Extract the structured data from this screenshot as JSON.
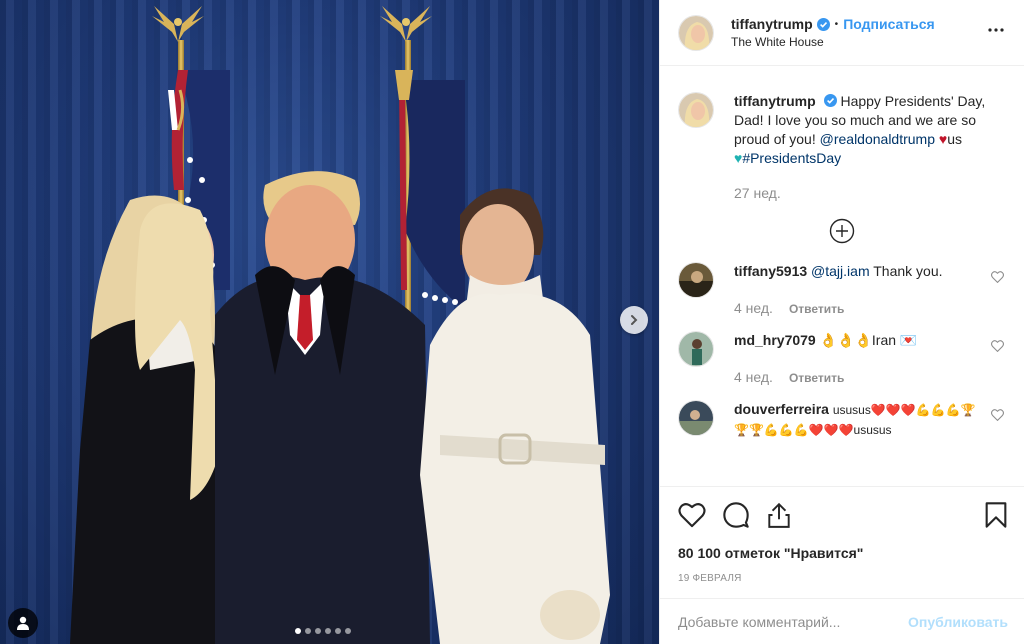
{
  "post": {
    "username": "tiffanytrump",
    "follow_label": "Подписаться",
    "separator": "•",
    "location": "The White House",
    "caption": {
      "username": "tiffanytrump",
      "text_part1": "Happy Presidents' Day, Dad! I love you so much and we are so proud of you! ",
      "mention": "@realdonaldtrump",
      "heart": "♥",
      "text_part2": "us",
      "heart2": "♥",
      "hashtag": "#PresidentsDay",
      "time": "27 нед."
    },
    "comments": [
      {
        "username": "tiffany5913",
        "mention": "@tajj.iam",
        "text": " Thank you.",
        "time": "4 нед.",
        "reply": "Ответить"
      },
      {
        "username": "md_hry7079",
        "text": "👌👌👌Iran 💌",
        "time": "4 нед.",
        "reply": "Ответить"
      },
      {
        "username": "douverferreira",
        "text": "ususus❤️❤️❤️💪💪💪🏆🏆🏆💪💪💪❤️❤️❤️ususus",
        "time": "",
        "reply": ""
      }
    ],
    "likes": "80 100 отметок \"Нравится\"",
    "date": "19 февраля",
    "add_comment_placeholder": "Добавьте комментарий...",
    "publish_label": "Опубликовать",
    "carousel": {
      "count": 6,
      "active": 0
    }
  },
  "colors": {
    "accent": "#3897f0",
    "link": "#003569",
    "muted": "#8e8e8e",
    "publish_disabled": "#b2dffc",
    "curtain": "#1f3b7a"
  },
  "icons": [
    "verified-badge-icon",
    "more-options-icon",
    "load-more-plus-icon",
    "heart-icon",
    "comment-icon",
    "share-icon",
    "bookmark-icon",
    "chevron-right-icon",
    "user-tag-icon"
  ]
}
